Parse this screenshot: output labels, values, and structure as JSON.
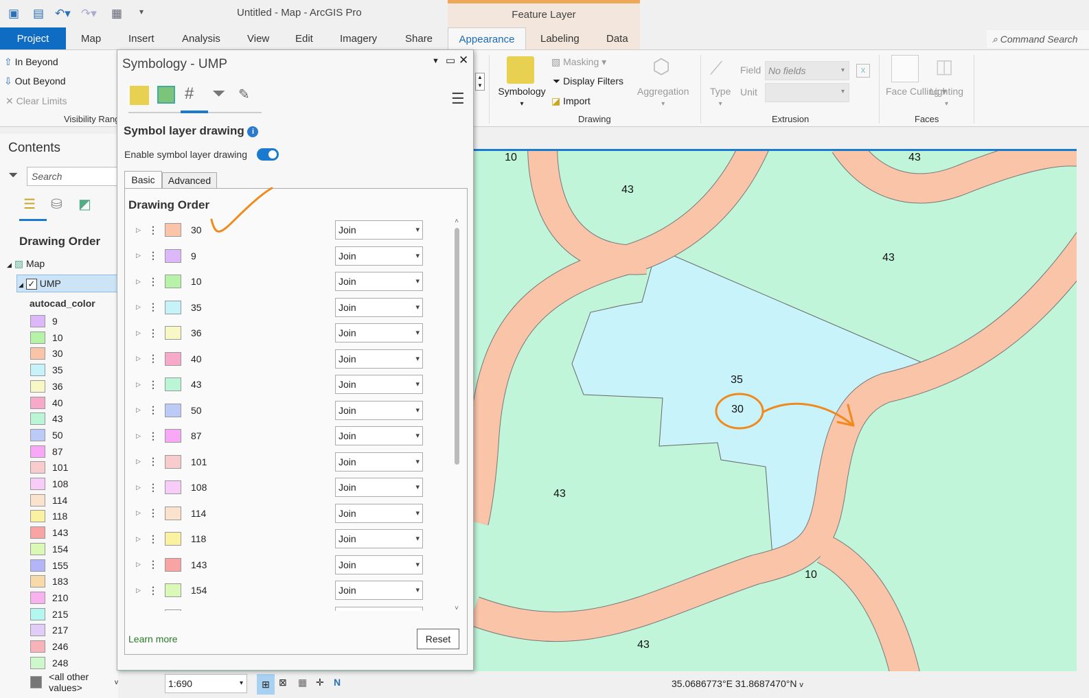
{
  "window": {
    "title": "Untitled - Map - ArcGIS Pro",
    "context_tab_group": "Feature Layer"
  },
  "tabs": [
    "Project",
    "Map",
    "Insert",
    "Analysis",
    "View",
    "Edit",
    "Imagery",
    "Share",
    "Appearance",
    "Labeling",
    "Data"
  ],
  "command_search": "Command Search",
  "ribbon": {
    "visibility": {
      "in_beyond": "In Beyond",
      "out_beyond": "Out Beyond",
      "clear_limits": "Clear Limits",
      "group": "Visibility Range"
    },
    "drawing": {
      "symbology": "Symbology",
      "masking": "Masking",
      "display_filters": "Display Filters",
      "import": "Import",
      "aggregation": "Aggregation",
      "group": "Drawing"
    },
    "extrusion": {
      "type": "Type",
      "field_label": "Field",
      "field_value": "No fields",
      "unit_label": "Unit",
      "group": "Extrusion"
    },
    "faces": {
      "face_culling": "Face Culling",
      "lighting": "Lighting",
      "group": "Faces"
    }
  },
  "contents": {
    "title": "Contents",
    "search_placeholder": "Search",
    "section": "Drawing Order",
    "map": "Map",
    "layer": "UMP",
    "field": "autocad_color",
    "legend": [
      {
        "label": "9",
        "color": "#dcb8fa"
      },
      {
        "label": "10",
        "color": "#b6f2a8"
      },
      {
        "label": "30",
        "color": "#f9c4a8"
      },
      {
        "label": "35",
        "color": "#c6f3fa"
      },
      {
        "label": "36",
        "color": "#f8f8c6"
      },
      {
        "label": "40",
        "color": "#f8a8c8"
      },
      {
        "label": "43",
        "color": "#baf5d6"
      },
      {
        "label": "50",
        "color": "#bccaf8"
      },
      {
        "label": "87",
        "color": "#f8a8f6"
      },
      {
        "label": "101",
        "color": "#f8cccc"
      },
      {
        "label": "108",
        "color": "#f8ccf8"
      },
      {
        "label": "114",
        "color": "#fae2cc"
      },
      {
        "label": "118",
        "color": "#faf2a0"
      },
      {
        "label": "143",
        "color": "#f8a4a4"
      },
      {
        "label": "154",
        "color": "#daf8b6"
      },
      {
        "label": "155",
        "color": "#b4b4f8"
      },
      {
        "label": "183",
        "color": "#f8daa8"
      },
      {
        "label": "210",
        "color": "#f8b2f0"
      },
      {
        "label": "215",
        "color": "#b2f8f0"
      },
      {
        "label": "217",
        "color": "#e2ccf8"
      },
      {
        "label": "246",
        "color": "#f8b2ba"
      },
      {
        "label": "248",
        "color": "#ccf8cc"
      }
    ],
    "other": {
      "label": "<all other values>",
      "color": "#777777"
    }
  },
  "panel": {
    "title": "Symbology - UMP",
    "heading": "Symbol layer drawing",
    "toggle_label": "Enable symbol layer drawing",
    "toggle_on": true,
    "tab_basic": "Basic",
    "tab_advanced": "Advanced",
    "section": "Drawing Order",
    "learn_more": "Learn more",
    "reset": "Reset",
    "rows": [
      {
        "label": "30",
        "color": "#f9c4a8",
        "mode": "Join"
      },
      {
        "label": "9",
        "color": "#dcb8fa",
        "mode": "Join"
      },
      {
        "label": "10",
        "color": "#b6f2a8",
        "mode": "Join"
      },
      {
        "label": "35",
        "color": "#c6f3fa",
        "mode": "Join"
      },
      {
        "label": "36",
        "color": "#f8f8c6",
        "mode": "Join"
      },
      {
        "label": "40",
        "color": "#f8a8c8",
        "mode": "Join"
      },
      {
        "label": "43",
        "color": "#baf5d6",
        "mode": "Join"
      },
      {
        "label": "50",
        "color": "#bccaf8",
        "mode": "Join"
      },
      {
        "label": "87",
        "color": "#f8a8f6",
        "mode": "Join"
      },
      {
        "label": "101",
        "color": "#f8cccc",
        "mode": "Join"
      },
      {
        "label": "108",
        "color": "#f8ccf8",
        "mode": "Join"
      },
      {
        "label": "114",
        "color": "#fae2cc",
        "mode": "Join"
      },
      {
        "label": "118",
        "color": "#faf2a0",
        "mode": "Join"
      },
      {
        "label": "143",
        "color": "#f8a4a4",
        "mode": "Join"
      },
      {
        "label": "154",
        "color": "#daf8b6",
        "mode": "Join"
      }
    ]
  },
  "map": {
    "labels": [
      "10",
      "43",
      "43",
      "43",
      "35",
      "30",
      "43",
      "10",
      "43"
    ]
  },
  "status": {
    "scale": "1:690",
    "coordinates": "35.0686773°E 31.8687470°N"
  }
}
